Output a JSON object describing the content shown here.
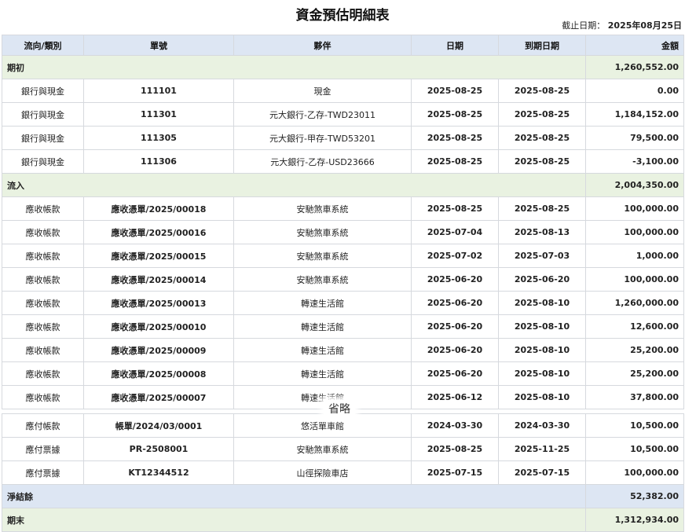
{
  "title": "資金預估明細表",
  "cutoff": {
    "label": "截止日期：",
    "value": "2025年08月25日"
  },
  "columns": [
    "流向/類別",
    "單號",
    "夥伴",
    "日期",
    "到期日期",
    "金額"
  ],
  "opening": {
    "label": "期初",
    "total": "1,260,552.00",
    "rows": [
      {
        "category": "銀行與現金",
        "doc": "111101",
        "partner": "現金",
        "date": "2025-08-25",
        "due": "2025-08-25",
        "amount": "0.00"
      },
      {
        "category": "銀行與現金",
        "doc": "111301",
        "partner": "元大銀行-乙存-TWD23011",
        "date": "2025-08-25",
        "due": "2025-08-25",
        "amount": "1,184,152.00"
      },
      {
        "category": "銀行與現金",
        "doc": "111305",
        "partner": "元大銀行-甲存-TWD53201",
        "date": "2025-08-25",
        "due": "2025-08-25",
        "amount": "79,500.00"
      },
      {
        "category": "銀行與現金",
        "doc": "111306",
        "partner": "元大銀行-乙存-USD23666",
        "date": "2025-08-25",
        "due": "2025-08-25",
        "amount": "-3,100.00"
      }
    ]
  },
  "inflow": {
    "label": "流入",
    "total": "2,004,350.00",
    "rows": [
      {
        "category": "應收帳款",
        "doc": "應收憑單/2025/00018",
        "partner": "安馳煞車系統",
        "date": "2025-08-25",
        "due": "2025-08-25",
        "amount": "100,000.00"
      },
      {
        "category": "應收帳款",
        "doc": "應收憑單/2025/00016",
        "partner": "安馳煞車系統",
        "date": "2025-07-04",
        "due": "2025-08-13",
        "amount": "100,000.00"
      },
      {
        "category": "應收帳款",
        "doc": "應收憑單/2025/00015",
        "partner": "安馳煞車系統",
        "date": "2025-07-02",
        "due": "2025-07-03",
        "amount": "1,000.00"
      },
      {
        "category": "應收帳款",
        "doc": "應收憑單/2025/00014",
        "partner": "安馳煞車系統",
        "date": "2025-06-20",
        "due": "2025-06-20",
        "amount": "100,000.00"
      },
      {
        "category": "應收帳款",
        "doc": "應收憑單/2025/00013",
        "partner": "轉速生活館",
        "date": "2025-06-20",
        "due": "2025-08-10",
        "amount": "1,260,000.00"
      },
      {
        "category": "應收帳款",
        "doc": "應收憑單/2025/00010",
        "partner": "轉速生活館",
        "date": "2025-06-20",
        "due": "2025-08-10",
        "amount": "12,600.00"
      },
      {
        "category": "應收帳款",
        "doc": "應收憑單/2025/00009",
        "partner": "轉速生活館",
        "date": "2025-06-20",
        "due": "2025-08-10",
        "amount": "25,200.00"
      },
      {
        "category": "應收帳款",
        "doc": "應收憑單/2025/00008",
        "partner": "轉速生活館",
        "date": "2025-06-20",
        "due": "2025-08-10",
        "amount": "25,200.00"
      },
      {
        "category": "應收帳款",
        "doc": "應收憑單/2025/00007",
        "partner": "轉速生活館",
        "date": "2025-06-12",
        "due": "2025-08-10",
        "amount": "37,800.00"
      }
    ]
  },
  "omitted_label": "省略",
  "outflow": {
    "rows": [
      {
        "category": "應付帳款",
        "doc": "帳單/2024/03/0001",
        "partner": "悠活單車館",
        "date": "2024-03-30",
        "due": "2024-03-30",
        "amount": "10,500.00"
      },
      {
        "category": "應付票據",
        "doc": "PR-2508001",
        "partner": "安馳煞車系統",
        "date": "2025-08-25",
        "due": "2025-11-25",
        "amount": "10,500.00"
      },
      {
        "category": "應付票據",
        "doc": "KT12344512",
        "partner": "山徑探險車店",
        "date": "2025-07-15",
        "due": "2025-07-15",
        "amount": "100,000.00"
      }
    ]
  },
  "net": {
    "label": "淨結餘",
    "total": "52,382.00"
  },
  "closing": {
    "label": "期末",
    "total": "1,312,934.00"
  }
}
